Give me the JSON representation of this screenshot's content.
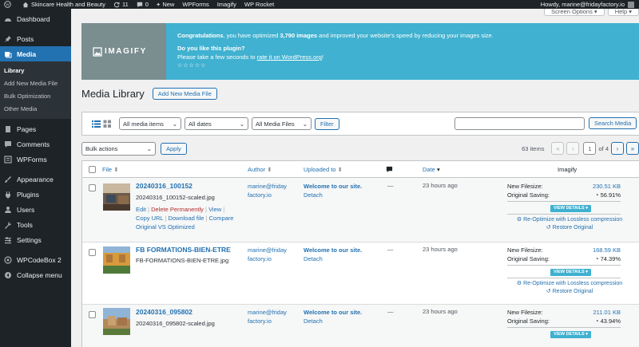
{
  "adminbar": {
    "site_name": "Skincare Health and Beauty",
    "updates_count": "11",
    "comments_count": "0",
    "new_label": "New",
    "items": [
      "WPForms",
      "Imagify",
      "WP Rocket"
    ],
    "howdy": "Howdy, marine@fridayfactory.io"
  },
  "screen": {
    "options": "Screen Options",
    "help": "Help"
  },
  "sidebar": {
    "items": [
      {
        "label": "Dashboard",
        "icon": "dashboard-icon"
      },
      {
        "label": "Posts",
        "icon": "pin-icon"
      },
      {
        "label": "Media",
        "icon": "media-icon"
      },
      {
        "label": "Pages",
        "icon": "page-icon"
      },
      {
        "label": "Comments",
        "icon": "comment-icon"
      },
      {
        "label": "WPForms",
        "icon": "form-icon"
      },
      {
        "label": "Appearance",
        "icon": "brush-icon"
      },
      {
        "label": "Plugins",
        "icon": "plug-icon"
      },
      {
        "label": "Users",
        "icon": "user-icon"
      },
      {
        "label": "Tools",
        "icon": "wrench-icon"
      },
      {
        "label": "Settings",
        "icon": "settings-icon"
      },
      {
        "label": "WPCodeBox 2",
        "icon": "code-icon"
      },
      {
        "label": "Collapse menu",
        "icon": "collapse-icon"
      }
    ],
    "media_sub": [
      "Library",
      "Add New Media File",
      "Bulk Optimization",
      "Other Media"
    ]
  },
  "notice": {
    "logo": "IMAGIFY",
    "line1_prefix": "Congratulations",
    "line1_mid": ", you have optimized ",
    "line1_count": "3,790 images",
    "line1_suffix": " and improved your website's speed by reducing your images size.",
    "question": "Do you like this plugin?",
    "rate_prefix": "Please take a few seconds to ",
    "rate_link": "rate it on WordPress.org",
    "rate_suffix": "!",
    "stars": "☆☆☆☆☆"
  },
  "page": {
    "title": "Media Library",
    "add_new": "Add New Media File"
  },
  "filters": {
    "type": "All media items",
    "dates": "All dates",
    "files": "All Media Files",
    "filter_btn": "Filter",
    "search_btn": "Search Media"
  },
  "tablenav": {
    "bulk": "Bulk actions",
    "apply": "Apply",
    "items": "63 items",
    "current_page": "1",
    "of_pages": "of 4",
    "first": "«",
    "prev": "‹",
    "next": "›",
    "last": "»"
  },
  "columns": {
    "file": "File",
    "author": "Author",
    "uploaded_to": "Uploaded to",
    "date": "Date",
    "imagify": "Imagify"
  },
  "rows": [
    {
      "title": "20240316_100152",
      "file": "20240316_100152-scaled.jpg",
      "actions": {
        "edit": "Edit",
        "delete": "Delete Permanently",
        "view": "View",
        "copy": "Copy URL",
        "download": "Download file",
        "compare": "Compare Original VS Optimized"
      },
      "author_a": "marine@friday",
      "author_b": "factory.io",
      "uploaded": "Welcome to our site.",
      "detach": "Detach",
      "comments": "—",
      "date": "23 hours ago",
      "new_filesize_label": "New Filesize:",
      "new_filesize": "230.51 KB",
      "saving_label": "Original Saving:",
      "saving": "56.91%",
      "view_details": "VIEW DETAILS",
      "reoptimize": "Re-Optimize with Lossless compression",
      "restore": "Restore Original"
    },
    {
      "title": "FB FORMATIONS-BIEN-ETRE",
      "file": "FB-FORMATIONS-BIEN-ETRE.jpg",
      "author_a": "marine@friday",
      "author_b": "factory.io",
      "uploaded": "Welcome to our site.",
      "detach": "Detach",
      "comments": "—",
      "date": "23 hours ago",
      "new_filesize_label": "New Filesize:",
      "new_filesize": "168.59 KB",
      "saving_label": "Original Saving:",
      "saving": "74.39%",
      "view_details": "VIEW DETAILS",
      "reoptimize": "Re-Optimize with Lossless compression",
      "restore": "Restore Original"
    },
    {
      "title": "20240316_095802",
      "file": "20240316_095802-scaled.jpg",
      "author_a": "marine@friday",
      "author_b": "factory.io",
      "uploaded": "Welcome to our site.",
      "detach": "Detach",
      "comments": "—",
      "date": "23 hours ago",
      "new_filesize_label": "New Filesize:",
      "new_filesize": "211.01 KB",
      "saving_label": "Original Saving:",
      "saving": "43.94%",
      "view_details": "VIEW DETAILS"
    }
  ],
  "colors": {
    "admin_dark": "#1d2327",
    "wp_blue": "#2271b1",
    "imagify_teal": "#40b1d0",
    "imagify_gray": "#7a8d8f"
  }
}
